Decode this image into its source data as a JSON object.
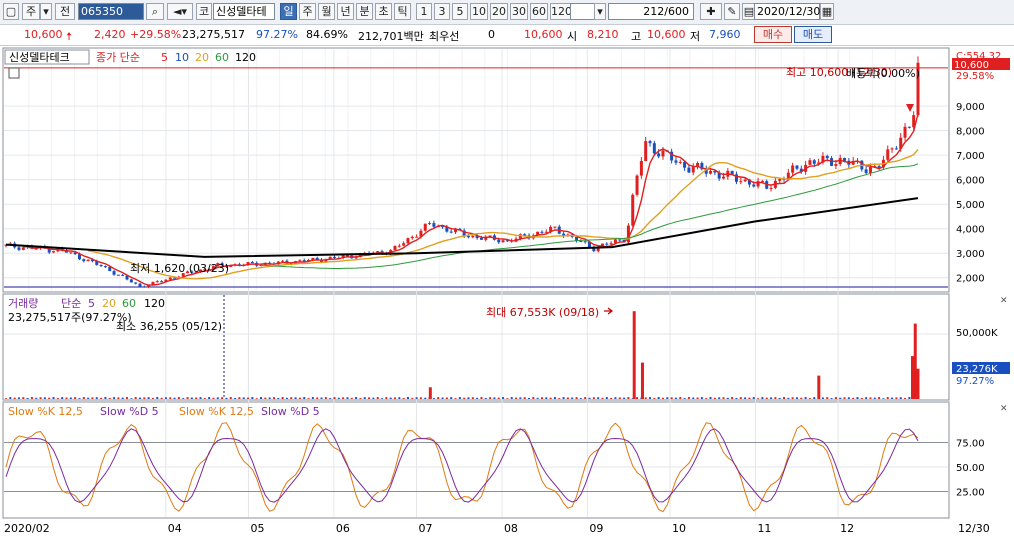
{
  "toolbar": {
    "type_label": "주",
    "prev_label": "전",
    "code_value": "065350",
    "market_label": "코",
    "stock_name": "신성델타테",
    "periods": [
      "일",
      "주",
      "월",
      "년",
      "분",
      "초",
      "틱"
    ],
    "period_selected": "일",
    "intervals": [
      "1",
      "3",
      "5",
      "10",
      "20",
      "30",
      "60",
      "120"
    ],
    "count_value": "212/600",
    "date_value": "2020/12/30"
  },
  "quote": {
    "price": "10,600",
    "change": "2,420",
    "change_pct": "+29.58%",
    "volume": "23,275,517",
    "ratio1": "97.27%",
    "ratio2": "84.69%",
    "amount": "212,701백만",
    "priority_label": "최우선",
    "priority_value": "0",
    "last": "10,600",
    "open_label": "시",
    "open": "8,210",
    "high_label": "고",
    "high": "10,600",
    "low_label": "저",
    "low": "7,960",
    "buy_label": "매수",
    "sell_label": "매도"
  },
  "price_panel": {
    "stock_label": "신성델타테크",
    "ma_label": "종가 단순",
    "ma_periods": [
      "5",
      "10",
      "20",
      "60",
      "120"
    ],
    "corner_label": "C:554.32",
    "price_badge": "10,600",
    "pct_badge": "29.58%",
    "high_annot": "최고 10,600 (12/30)",
    "low_annot": "최저 1,620 (03/23)",
    "extra_annot": "배등락(0.00%)",
    "y_ticks": [
      "9,000",
      "8,000",
      "7,000",
      "6,000",
      "5,000",
      "4,000",
      "3,000",
      "2,000"
    ]
  },
  "volume_panel": {
    "title": "거래량",
    "ma_label": "단순",
    "ma_periods": [
      "5",
      "20",
      "60",
      "120"
    ],
    "info": "23,275,517주(97.27%)",
    "min_annot": "최소 36,255 (05/12)",
    "max_annot": "최대 67,553K (09/18)",
    "y_tick": "50,000K",
    "badge": "23,276K",
    "badge_pct": "97.27%"
  },
  "stoch_panel": {
    "label1": "Slow %K 12,5",
    "label2": "Slow %D 5",
    "label3": "Slow %K 12,5",
    "label4": "Slow %D 5",
    "y_ticks": [
      "75.00",
      "50.00",
      "25.00"
    ]
  },
  "x_axis": {
    "labels": [
      "2020/02",
      "04",
      "05",
      "06",
      "07",
      "08",
      "09",
      "10",
      "11",
      "12",
      "12/30"
    ]
  },
  "colors": {
    "up": "#e02020",
    "down": "#1a4fc0",
    "ma5": "#e02020",
    "ma20": "#e0a020",
    "ma60": "#2e9a3c",
    "ma120": "#000000"
  },
  "chart_data": {
    "type": "candlestick",
    "x_range": [
      "2020/02/03",
      "2020/12/30"
    ],
    "ylim": [
      1500,
      10800
    ],
    "price_series": [
      {
        "date": "2020/02/03",
        "close": 3300
      },
      {
        "date": "2020/02/24",
        "close": 3100
      },
      {
        "date": "2020/03/10",
        "close": 2400
      },
      {
        "date": "2020/03/23",
        "close": 1620
      },
      {
        "date": "2020/04/06",
        "close": 2100
      },
      {
        "date": "2020/04/20",
        "close": 2500
      },
      {
        "date": "2020/05/12",
        "close": 2600
      },
      {
        "date": "2020/06/01",
        "close": 2800
      },
      {
        "date": "2020/06/22",
        "close": 3100
      },
      {
        "date": "2020/07/06",
        "close": 4200
      },
      {
        "date": "2020/07/20",
        "close": 3700
      },
      {
        "date": "2020/08/03",
        "close": 3500
      },
      {
        "date": "2020/08/20",
        "close": 4000
      },
      {
        "date": "2020/09/03",
        "close": 3200
      },
      {
        "date": "2020/09/15",
        "close": 3600
      },
      {
        "date": "2020/09/18",
        "close": 5600
      },
      {
        "date": "2020/09/22",
        "close": 7500
      },
      {
        "date": "2020/10/05",
        "close": 6600
      },
      {
        "date": "2020/10/20",
        "close": 6200
      },
      {
        "date": "2020/11/05",
        "close": 5700
      },
      {
        "date": "2020/11/20",
        "close": 6700
      },
      {
        "date": "2020/12/01",
        "close": 6800
      },
      {
        "date": "2020/12/15",
        "close": 6400
      },
      {
        "date": "2020/12/23",
        "close": 7700
      },
      {
        "date": "2020/12/28",
        "close": 8200
      },
      {
        "date": "2020/12/30",
        "close": 10600
      }
    ],
    "ma120": [
      {
        "date": "2020/02/03",
        "value": 3350
      },
      {
        "date": "2020/04/15",
        "value": 2850
      },
      {
        "date": "2020/07/01",
        "value": 3000
      },
      {
        "date": "2020/09/10",
        "value": 3250
      },
      {
        "date": "2020/11/01",
        "value": 4300
      },
      {
        "date": "2020/12/30",
        "value": 5250
      }
    ],
    "volume_max_k": 67553,
    "volume_events": [
      {
        "date": "2020/07/06",
        "value_k": 9000
      },
      {
        "date": "2020/09/18",
        "value_k": 67553
      },
      {
        "date": "2020/09/21",
        "value_k": 28000
      },
      {
        "date": "2020/11/24",
        "value_k": 18000
      },
      {
        "date": "2020/12/28",
        "value_k": 33000
      },
      {
        "date": "2020/12/29",
        "value_k": 58000
      },
      {
        "date": "2020/12/30",
        "value_k": 23276
      }
    ],
    "stoch_ylim": [
      0,
      100
    ]
  }
}
